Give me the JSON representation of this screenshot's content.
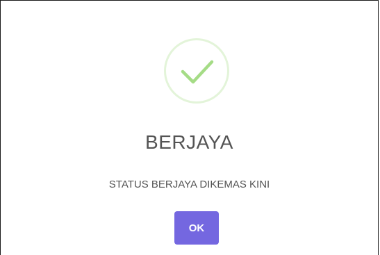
{
  "dialog": {
    "icon": "check-icon",
    "icon_color": "#a5dc86",
    "icon_ring_color": "#e3f4d9",
    "title": "BERJAYA",
    "message": "STATUS BERJAYA DIKEMAS KINI",
    "ok_label": "OK",
    "ok_button_color": "#7467e0"
  }
}
